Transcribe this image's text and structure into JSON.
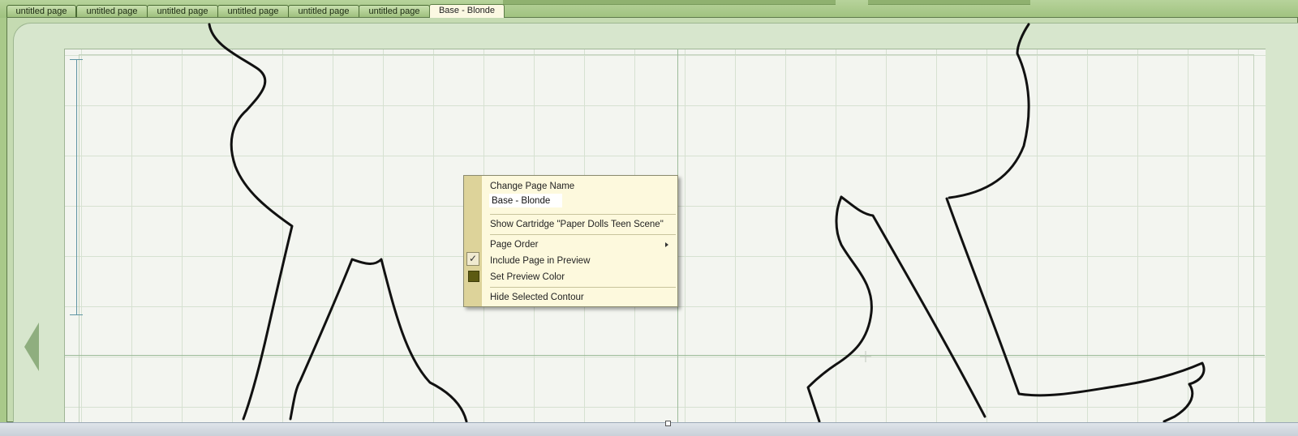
{
  "tabs": [
    {
      "label": "untitled page"
    },
    {
      "label": "untitled page"
    },
    {
      "label": "untitled page"
    },
    {
      "label": "untitled page"
    },
    {
      "label": "untitled page"
    },
    {
      "label": "untitled page"
    },
    {
      "label": "Base - Blonde",
      "active": true
    }
  ],
  "context_menu": {
    "change_name_label": "Change Page Name",
    "page_name_value": "Base - Blonde",
    "show_cartridge": "Show Cartridge \"Paper Dolls Teen Scene\"",
    "page_order": "Page Order",
    "include_in_preview": "Include Page in Preview",
    "include_in_preview_checked": true,
    "set_preview_color": "Set Preview Color",
    "preview_color": "#5c5a12",
    "hide_selected_contour": "Hide Selected Contour"
  },
  "colors": {
    "window_bg": "#a9c98a",
    "mat": "#d7e6cd",
    "canvas": "#f3f5f0",
    "contour": "#111111",
    "menu_bg": "#fdf9dd"
  },
  "icons": {
    "submenu": "chevron-right-icon",
    "check": "check-icon",
    "scroll_left": "left-arrow-icon"
  }
}
